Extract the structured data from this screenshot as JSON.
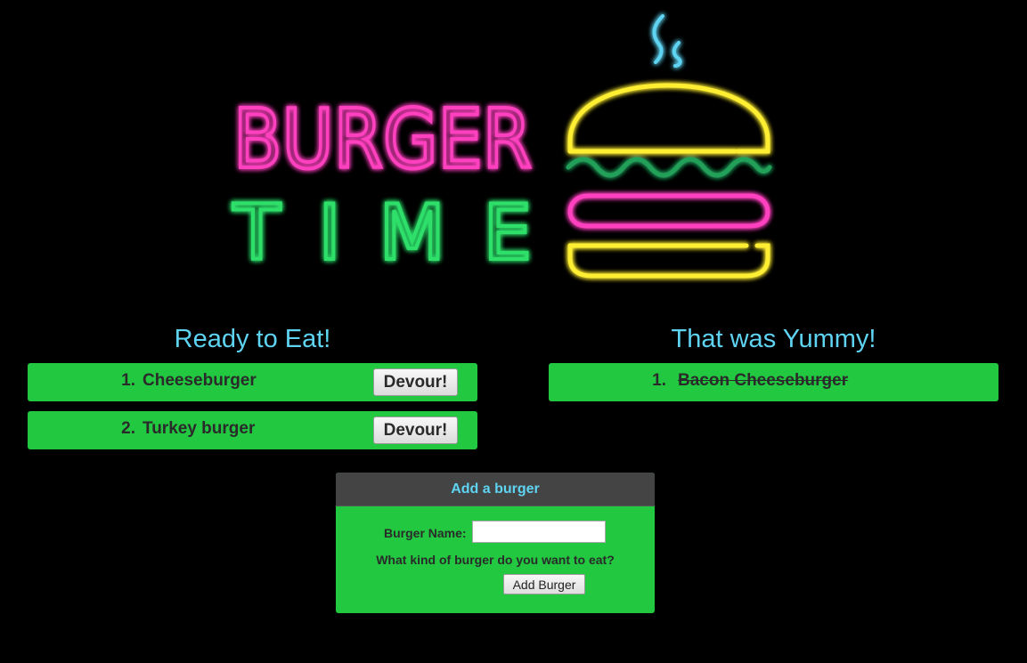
{
  "logo": {
    "line1": "BURGER",
    "line2": "TIME",
    "colors": {
      "pink": "#ff3fbf",
      "green": "#2fe06a",
      "yellow": "#ffee33",
      "blue": "#5fd4f2",
      "lettuce": "#22a05a"
    }
  },
  "ready": {
    "heading": "Ready to Eat!",
    "items": [
      {
        "number": "1.",
        "name": "Cheeseburger",
        "button": "Devour!"
      },
      {
        "number": "2.",
        "name": "Turkey burger",
        "button": "Devour!"
      }
    ]
  },
  "devoured": {
    "heading": "That was Yummy!",
    "items": [
      {
        "number": "1.",
        "name": "Bacon Cheeseburger"
      }
    ]
  },
  "add_form": {
    "title": "Add a burger",
    "label": "Burger Name:",
    "input_value": "",
    "input_placeholder": "",
    "help": "What kind of burger do you want to eat?",
    "submit": "Add Burger"
  },
  "theme": {
    "background": "#000000",
    "item_bg": "#21c840",
    "heading_color": "#5fd4f2",
    "panel_header_bg": "#444444"
  }
}
